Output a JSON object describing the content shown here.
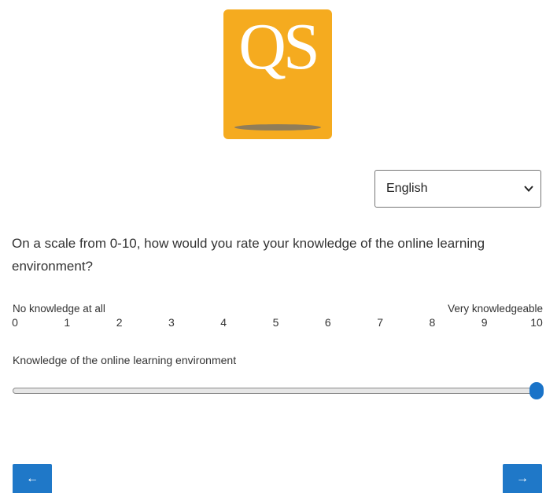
{
  "logo": {
    "text": "QS",
    "color": "#f5ab1f"
  },
  "language_select": {
    "value": "English",
    "icon": "chevron-down-icon"
  },
  "question": {
    "text": "On a scale from 0-10, how would you rate your knowledge of the online learning environment?"
  },
  "scale": {
    "anchor_left": "No knowledge at all",
    "anchor_right": "Very knowledgeable",
    "numbers": [
      "0",
      "1",
      "2",
      "3",
      "4",
      "5",
      "6",
      "7",
      "8",
      "9",
      "10"
    ],
    "min": 0,
    "max": 10
  },
  "slider": {
    "label": "Knowledge of the online learning environment",
    "value": 10,
    "accent": "#1a73c8"
  },
  "nav": {
    "prev_label": "←",
    "next_label": "→",
    "color": "#1f78c8"
  }
}
